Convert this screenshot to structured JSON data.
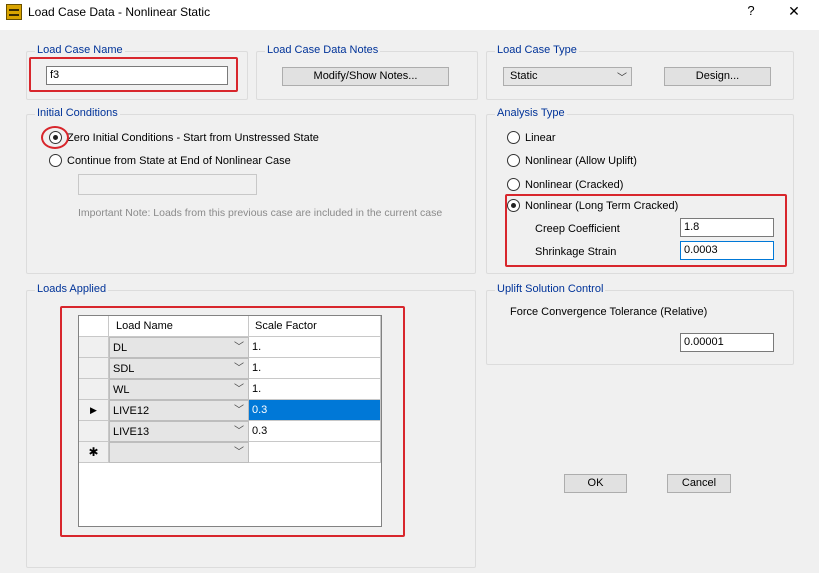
{
  "window": {
    "title": "Load Case Data - Nonlinear Static",
    "help_label": "?",
    "close_label": "✕"
  },
  "load_case_name": {
    "legend": "Load Case Name",
    "value": "f3"
  },
  "notes": {
    "legend": "Load Case Data Notes",
    "button_label": "Modify/Show Notes..."
  },
  "load_case_type": {
    "legend": "Load Case Type",
    "selected": "Static",
    "design_button_label": "Design..."
  },
  "initial_conditions": {
    "legend": "Initial Conditions",
    "options": [
      {
        "label": "Zero Initial Conditions - Start from Unstressed State",
        "checked": true
      },
      {
        "label": "Continue from State at End of Nonlinear Case",
        "checked": false
      }
    ],
    "case_value": "",
    "note": "Important Note:  Loads from this previous case are included in the current case"
  },
  "analysis_type": {
    "legend": "Analysis Type",
    "options": [
      {
        "label": "Linear",
        "checked": false
      },
      {
        "label": "Nonlinear (Allow Uplift)",
        "checked": false
      },
      {
        "label": "Nonlinear (Cracked)",
        "checked": false
      },
      {
        "label": "Nonlinear (Long Term Cracked)",
        "checked": true
      }
    ],
    "creep_label": "Creep Coefficient",
    "creep_value": "1.8",
    "shrinkage_label": "Shrinkage Strain",
    "shrinkage_value": "0.0003"
  },
  "loads_applied": {
    "legend": "Loads Applied",
    "columns": [
      "Load Name",
      "Scale Factor"
    ],
    "rows": [
      {
        "marker": "",
        "name": "DL",
        "scale": "1."
      },
      {
        "marker": "",
        "name": "SDL",
        "scale": "1."
      },
      {
        "marker": "",
        "name": "WL",
        "scale": "1."
      },
      {
        "marker": "▶",
        "name": "LIVE12",
        "scale": "0.3"
      },
      {
        "marker": "",
        "name": "LIVE13",
        "scale": "0.3"
      },
      {
        "marker": "✱",
        "name": "",
        "scale": ""
      }
    ]
  },
  "uplift": {
    "legend": "Uplift Solution Control",
    "tolerance_label": "Force Convergence Tolerance (Relative)",
    "tolerance_value": "0.00001"
  },
  "actions": {
    "ok_label": "OK",
    "cancel_label": "Cancel"
  },
  "colors": {
    "annotation_red": "#d8262c",
    "legend_blue": "#003399",
    "selection_blue": "#0078d7"
  }
}
